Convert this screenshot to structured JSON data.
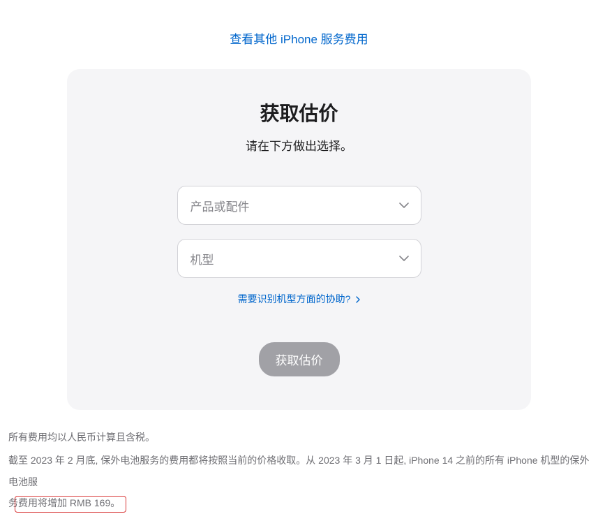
{
  "topLink": "查看其他 iPhone 服务费用",
  "card": {
    "title": "获取估价",
    "subtitle": "请在下方做出选择。",
    "select1": "产品或配件",
    "select2": "机型",
    "helpLink": "需要识别机型方面的协助?",
    "button": "获取估价"
  },
  "footer": {
    "line1": "所有费用均以人民币计算且含税。",
    "line2a": "截至 2023 年 2 月底, 保外电池服务的费用都将按照当前的价格收取。从 2023 年 3 月 1 日起, iPhone 14 之前的所有 iPhone 机型的保外电池服",
    "line2b_pre": "务",
    "line2b_hl": "费用将增加 RMB 169。"
  }
}
